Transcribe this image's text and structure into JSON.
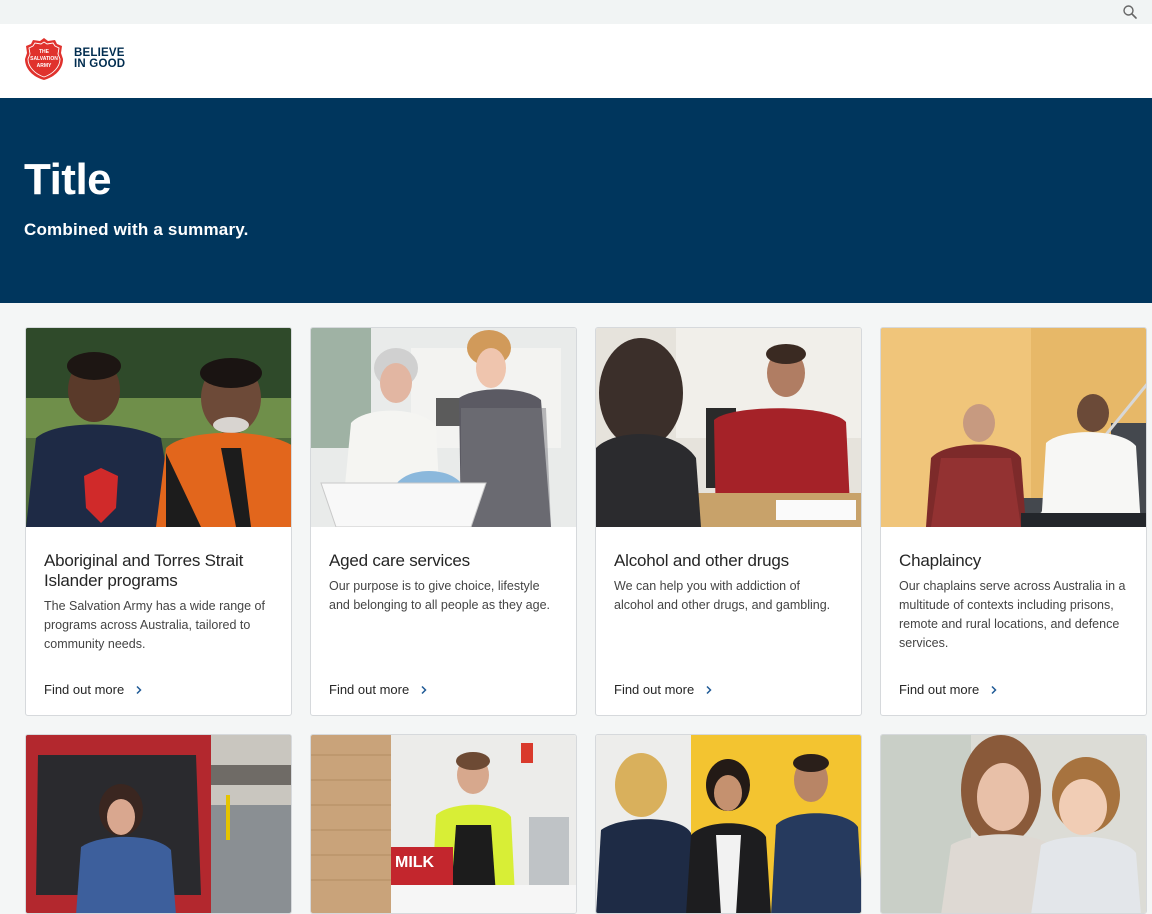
{
  "header": {
    "tagline_line1": "BELIEVE",
    "tagline_line2": "IN GOOD",
    "logo_icon": "salvation-army-shield",
    "search_icon": "search-icon"
  },
  "hero": {
    "title": "Title",
    "summary": "Combined with a summary."
  },
  "colors": {
    "hero_bg": "#00365d",
    "brand_red": "#e0322d",
    "link_chevron": "#1f5a96"
  },
  "cards": [
    {
      "title": "Aboriginal and Torres Strait Islander programs",
      "description": "The Salvation Army has a wide range of programs across Australia, tailored to community needs.",
      "link": "Find out more"
    },
    {
      "title": "Aged care services",
      "description": "Our purpose is to give choice, lifestyle and belonging to all people as they age.",
      "link": "Find out more"
    },
    {
      "title": "Alcohol and other drugs",
      "description": "We can help you with addiction of alcohol and other drugs, and gambling.",
      "link": "Find out more"
    },
    {
      "title": "Chaplaincy",
      "description": "Our chaplains serve across Australia in a multitude of contexts including prisons, remote and rural locations, and defence services.",
      "link": "Find out more"
    }
  ]
}
